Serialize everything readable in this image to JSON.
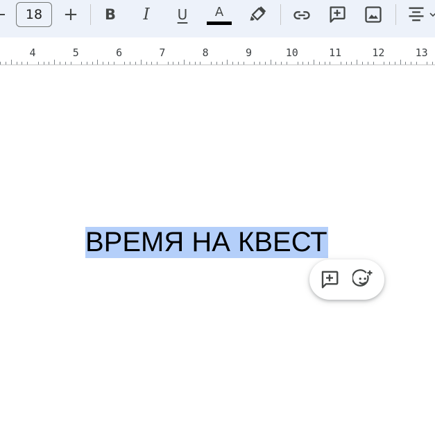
{
  "toolbar": {
    "font_size": "18",
    "decrease_symbol": "−",
    "increase_symbol": "+",
    "bold_label": "B",
    "italic_label": "I",
    "underline_label": "U",
    "text_color_label": "A",
    "text_color": "#000000",
    "icons": [
      "minus-icon",
      "plus-icon",
      "bold-icon",
      "italic-icon",
      "underline-icon",
      "text-color-icon",
      "highlighter-icon",
      "link-icon",
      "add-comment-icon",
      "image-icon",
      "align-center-icon",
      "chevron-down-icon"
    ]
  },
  "ruler": {
    "numbers": [
      "4",
      "5",
      "6",
      "7",
      "8",
      "9",
      "10",
      "11",
      "12",
      "13"
    ]
  },
  "document": {
    "selected_text": "ВРЕМЯ НА КВЕСТ",
    "selection_color": "#b4cffa"
  },
  "floating_actions": {
    "icons": [
      "add-comment-icon",
      "add-emoji-reaction-icon"
    ]
  }
}
